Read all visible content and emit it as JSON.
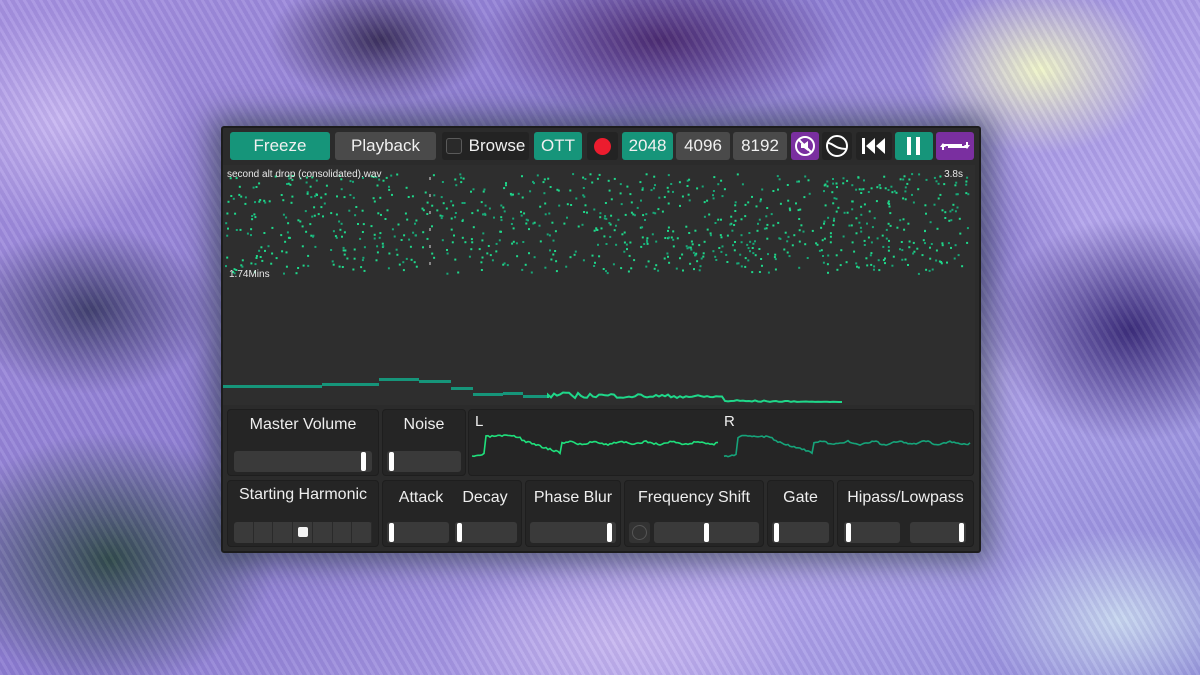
{
  "toolbar": {
    "freeze_label": "Freeze",
    "playback_label": "Playback",
    "browse_label": "Browse",
    "browse_checked": false,
    "ott_label": "OTT",
    "record_icon": "record-dot",
    "fft_sizes": [
      "2048",
      "4096",
      "8192"
    ],
    "fft_selected": "2048",
    "mute_icon": "mute-icon",
    "tone_icon": "sine-circle-icon",
    "rewind_icon": "skip-back-icon",
    "pause_icon": "pause-icon",
    "loop_icon": "loop-icon"
  },
  "spectrogram": {
    "file_name": "second alt drop (consolidated).wav",
    "duration_label": "3.8s",
    "length_label": "1.74Mins"
  },
  "controls": {
    "master_volume": {
      "label": "Master Volume",
      "value": 0.97
    },
    "noise": {
      "label": "Noise",
      "value": 0.0
    },
    "scope": {
      "left_label": "L",
      "right_label": "R"
    },
    "starting_harmonic": {
      "label": "Starting Harmonic",
      "segments": 7,
      "selected": 4
    },
    "attack": {
      "label": "Attack",
      "value": 0.0
    },
    "decay": {
      "label": "Decay",
      "value": 0.0
    },
    "phase_blur": {
      "label": "Phase Blur",
      "value": 0.98
    },
    "frequency_shift": {
      "label": "Frequency Shift",
      "value": 0.5,
      "toggle_on": false
    },
    "gate": {
      "label": "Gate",
      "value": 0.0
    },
    "hipass_lowpass": {
      "label": "Hipass/Lowpass",
      "hipass": 0.0,
      "lowpass": 1.0
    }
  },
  "colors": {
    "accent_green": "#16957a",
    "accent_purple": "#7a2fa0",
    "record_red": "#ec1c2e",
    "spectrum_green": "#1fd88a"
  }
}
